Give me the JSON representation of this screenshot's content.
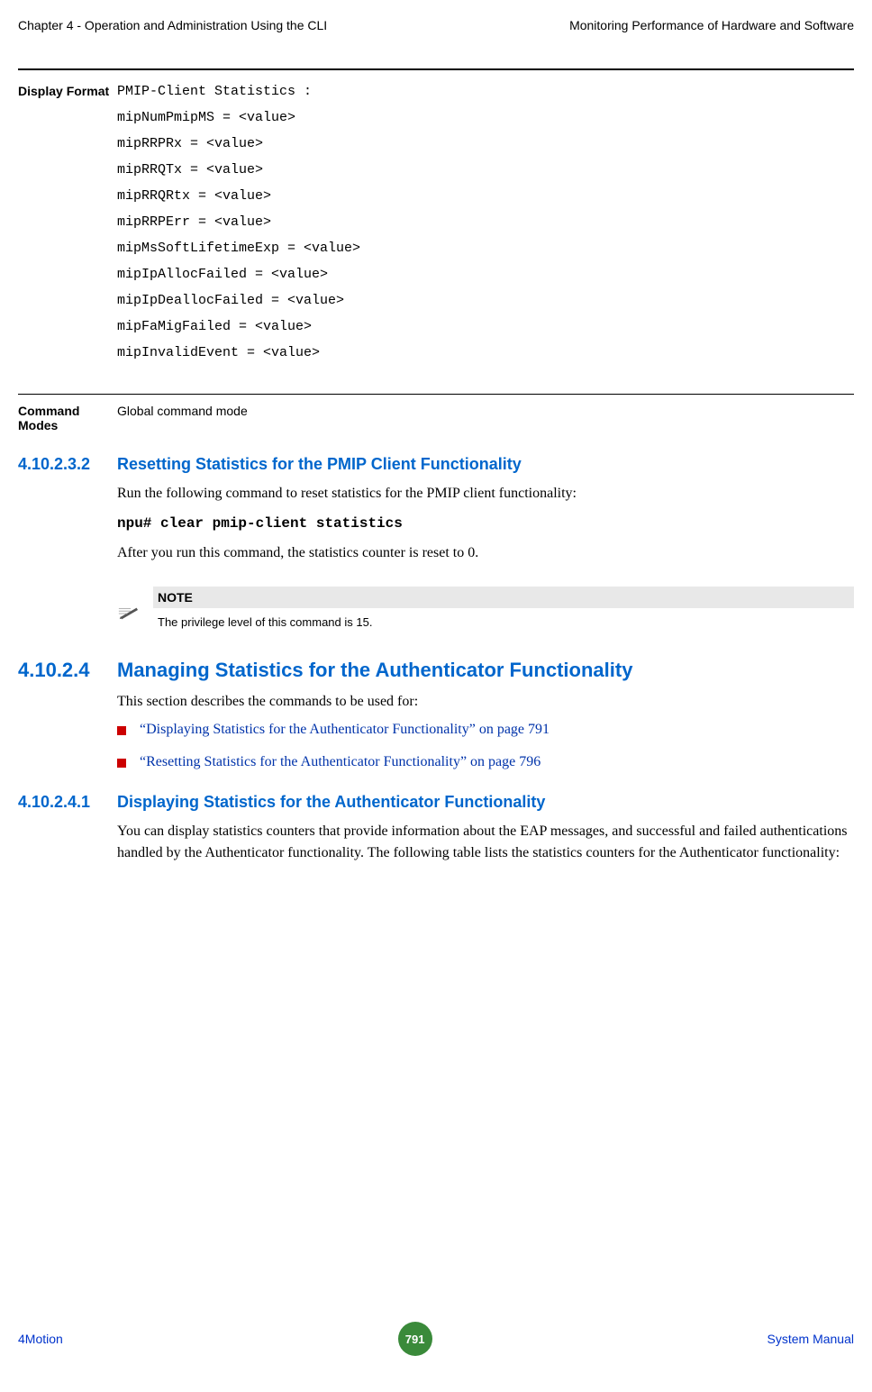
{
  "header": {
    "left": "Chapter 4 - Operation and Administration Using the CLI",
    "right": "Monitoring Performance of Hardware and Software"
  },
  "display_format": {
    "label": "Display Format",
    "lines": [
      "PMIP-Client Statistics :",
      "mipNumPmipMS = <value>",
      "mipRRPRx = <value>",
      "mipRRQTx = <value>",
      "mipRRQRtx = <value>",
      "mipRRPErr = <value>",
      "mipMsSoftLifetimeExp = <value>",
      "mipIpAllocFailed = <value>",
      "mipIpDeallocFailed = <value>",
      "mipFaMigFailed = <value>",
      "mipInvalidEvent = <value>"
    ]
  },
  "command_modes": {
    "label": "Command Modes",
    "text": "Global command mode"
  },
  "sec_41023102": {
    "num": "4.10.2.3.2",
    "title": "Resetting Statistics for the PMIP Client Functionality",
    "body1": "Run the following command to reset statistics for the PMIP client functionality:",
    "cmd": "npu# clear pmip-client statistics",
    "body2": "After you run this command, the statistics counter is reset to 0."
  },
  "note": {
    "title": "NOTE",
    "text": "The privilege level of this command is 15."
  },
  "sec_410241": {
    "num": "4.10.2.4",
    "title": "Managing Statistics for the Authenticator Functionality",
    "body": "This section describes the commands to be used for:",
    "bullets": [
      "“Displaying Statistics for the Authenticator Functionality” on page 791",
      "“Resetting Statistics for the Authenticator Functionality” on page 796"
    ]
  },
  "sec_4102411": {
    "num": "4.10.2.4.1",
    "title": "Displaying Statistics for the Authenticator Functionality",
    "body": "You can display statistics counters that provide information about the EAP messages, and successful and failed authentications handled by the Authenticator functionality. The following table lists the statistics counters for the Authenticator functionality:"
  },
  "footer": {
    "left": "4Motion",
    "page": "791",
    "right": "System Manual"
  }
}
